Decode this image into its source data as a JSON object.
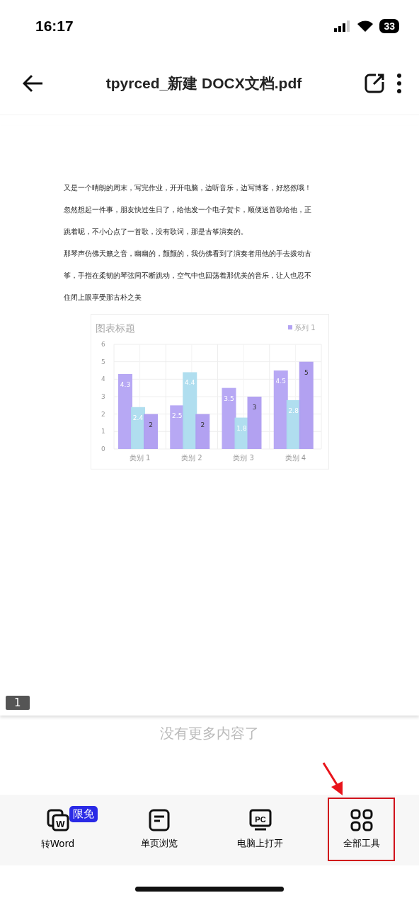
{
  "status_bar": {
    "time": "16:17",
    "battery": "33"
  },
  "header": {
    "title": "tpyrced_新建 DOCX文档.pdf"
  },
  "document": {
    "paragraphs": [
      "又是一个晴朗的周末，写完作业，开开电脑，边听音乐，边写博客，好悠然哦！",
      "忽然想起一件事，朋友快过生日了，给他发一个电子贺卡，顺便送首歌给他，正",
      "跳着呢，不小心点了一首歌，没有歌词，那是古筝演奏的。",
      "那琴声仿佛天籁之音，幽幽的，颤颤的，我仿佛看到了演奏者用他的手去拨动古",
      "筝，手指在柔韧的琴弦间不断跳动，空气中也回荡着那优美的音乐，让人也忍不",
      "住闭上眼享受那古朴之美"
    ],
    "chart_data": {
      "type": "bar",
      "title": "图表标题",
      "categories": [
        "类别 1",
        "类别 2",
        "类别 3",
        "类别 4"
      ],
      "ylim": [
        0,
        6
      ],
      "grid": true,
      "yticks": [
        0,
        1,
        2,
        3,
        4,
        5,
        6
      ],
      "data_labels": true,
      "series": [
        {
          "name": "系列 1",
          "color": "#b3a3f3",
          "values": [
            4.3,
            2.5,
            3.5,
            4.5
          ]
        },
        {
          "color": "#acdcee",
          "values": [
            2.4,
            4.4,
            1.8,
            2.8
          ]
        },
        {
          "color": "#ae9cf0",
          "values": [
            2,
            2,
            3,
            5
          ]
        }
      ]
    },
    "page_number": "1"
  },
  "end_note": "没有更多内容了",
  "toolbar": [
    {
      "kind": "word",
      "label": "转Word",
      "icon_label": "W",
      "badge": "限免",
      "highlighted": false
    },
    {
      "kind": "page",
      "label": "单页浏览",
      "highlighted": false
    },
    {
      "kind": "pc",
      "label": "电脑上打开",
      "icon_label": "PC",
      "highlighted": false
    },
    {
      "kind": "grid",
      "label": "全部工具",
      "highlighted": true
    }
  ]
}
